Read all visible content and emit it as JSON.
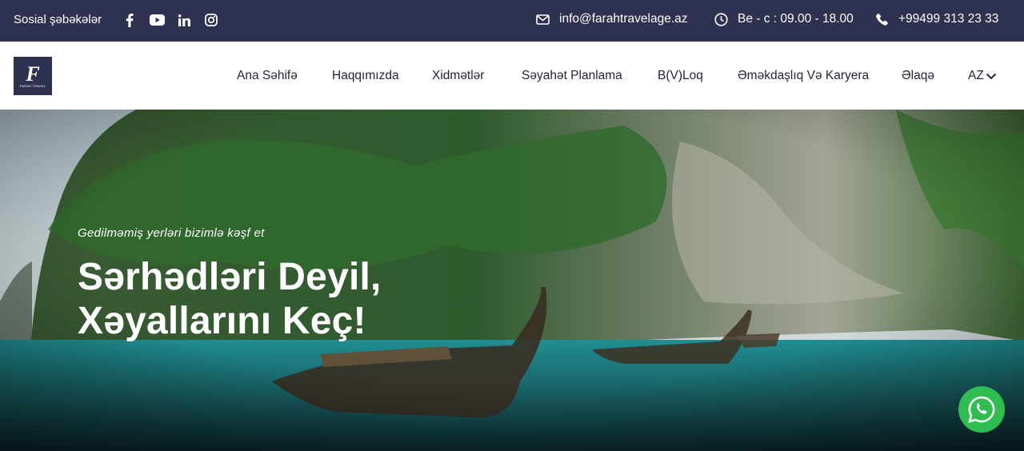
{
  "topbar": {
    "social_label": "Sosial şəbəkələr",
    "social_icons": [
      "facebook-icon",
      "youtube-icon",
      "linkedin-icon",
      "instagram-icon"
    ],
    "email": "info@farahtravelage.az",
    "hours": "Be - c : 09.00 - 18.00",
    "phone": "+99499 313 23 33",
    "background": "#2f3150"
  },
  "logo": {
    "mark": "F",
    "text": "FARAH TRAVEL"
  },
  "nav": {
    "items": [
      {
        "label": "Ana Səhifə"
      },
      {
        "label": "Haqqımızda"
      },
      {
        "label": "Xidmətlər"
      },
      {
        "label": "Səyahət Planlama"
      },
      {
        "label": "B(V)Loq"
      },
      {
        "label": "Əməkdaşlıq Və Karyera"
      },
      {
        "label": "Əlaqə"
      }
    ],
    "language": "AZ"
  },
  "hero": {
    "subtitle": "Gedilməmiş yerləri bizimlə kəşf et",
    "title_line1": "Sərhədləri Deyil,",
    "title_line2": "Xəyallarını Keç!"
  },
  "whatsapp": {
    "icon": "whatsapp-icon",
    "color": "#2fbd4f"
  }
}
